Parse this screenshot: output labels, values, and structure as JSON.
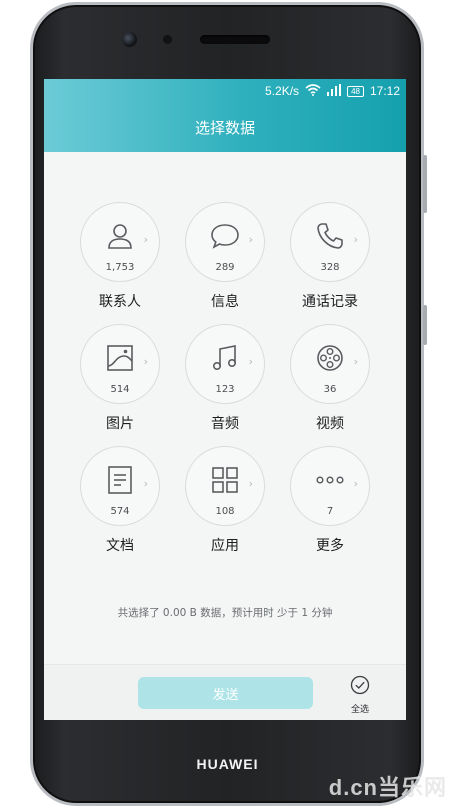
{
  "status_bar": {
    "speed": "5.2K/s",
    "battery": "48",
    "time": "17:12"
  },
  "header": {
    "title": "选择数据"
  },
  "categories": [
    {
      "label": "联系人",
      "count": "1,753",
      "icon": "contact-icon"
    },
    {
      "label": "信息",
      "count": "289",
      "icon": "message-icon"
    },
    {
      "label": "通话记录",
      "count": "328",
      "icon": "phone-icon"
    },
    {
      "label": "图片",
      "count": "514",
      "icon": "picture-icon"
    },
    {
      "label": "音频",
      "count": "123",
      "icon": "music-icon"
    },
    {
      "label": "视频",
      "count": "36",
      "icon": "film-reel-icon"
    },
    {
      "label": "文档",
      "count": "574",
      "icon": "document-icon"
    },
    {
      "label": "应用",
      "count": "108",
      "icon": "apps-grid-icon"
    },
    {
      "label": "更多",
      "count": "7",
      "icon": "more-dots-icon"
    }
  ],
  "summary": "共选择了 0.00 B 数据，预计用时 少于 1 分钟",
  "bottom_bar": {
    "send_label": "发送",
    "select_all_label": "全选"
  },
  "device": {
    "brand": "HUAWEI"
  },
  "watermark": "d.cn当乐网",
  "colors": {
    "header_accent": "#2fb0bd",
    "send_button_disabled": "#aee4e7"
  }
}
